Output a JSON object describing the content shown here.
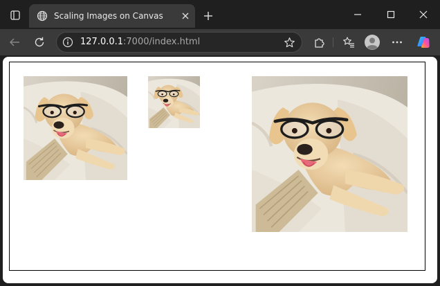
{
  "window": {
    "tab_title": "Scaling Images on Canvas",
    "icons": {
      "tab_actions": "tab-actions-icon",
      "favicon": "globe-icon",
      "close_tab": "close-icon",
      "new_tab": "plus-icon",
      "minimize": "minimize-icon",
      "maximize": "maximize-icon",
      "close_window": "close-icon"
    }
  },
  "toolbar": {
    "url_host": "127.0.0.1",
    "url_path": ":7000/index.html",
    "icons": {
      "back": "arrow-left-icon",
      "reload": "reload-icon",
      "site_info": "info-icon",
      "bookmark": "star-icon",
      "extensions": "puzzle-icon",
      "favorites": "favorites-icon",
      "profile": "avatar-icon",
      "menu": "more-horizontal-icon",
      "copilot": "copilot-icon"
    }
  },
  "page": {
    "images": [
      {
        "name": "dog-image-original",
        "scale": 1
      },
      {
        "name": "dog-image-half",
        "scale": 0.5
      },
      {
        "name": "dog-image-enlarged",
        "scale": 1.5
      }
    ]
  },
  "colors": {
    "chrome_dark": "#1f1f1f",
    "toolbar": "#3a3a3a",
    "active_tab": "#3a3a3a",
    "page_bg": "#ffffff",
    "canvas_border": "#000000"
  }
}
